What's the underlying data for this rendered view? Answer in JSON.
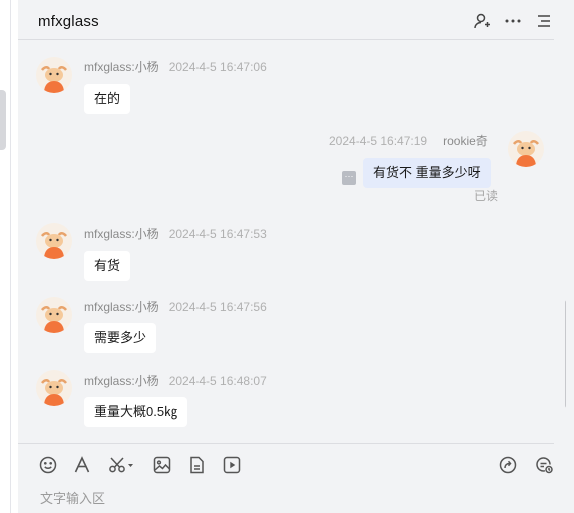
{
  "header": {
    "title": "mfxglass",
    "icons": [
      "add-user-icon",
      "more-icon",
      "list-icon"
    ]
  },
  "messages": [
    {
      "side": "left",
      "name": "mfxglass:小杨",
      "time": "2024-4-5 16:47:06",
      "text": "在的"
    },
    {
      "side": "right",
      "name": "rookie奇",
      "time": "2024-4-5 16:47:19",
      "text": "有货不  重量多少呀",
      "status": "已读"
    },
    {
      "side": "left",
      "name": "mfxglass:小杨",
      "time": "2024-4-5 16:47:53",
      "text": "有货"
    },
    {
      "side": "left",
      "name": "mfxglass:小杨",
      "time": "2024-4-5 16:47:56",
      "text": "需要多少"
    },
    {
      "side": "left",
      "name": "mfxglass:小杨",
      "time": "2024-4-5 16:48:07",
      "text": "重量大概0.5㎏"
    }
  ],
  "toolbar": {
    "icons": [
      "emoji-icon",
      "font-icon",
      "scissors-icon",
      "image-icon",
      "file-icon",
      "video-icon",
      "share-icon",
      "history-icon"
    ]
  },
  "input": {
    "placeholder": "文字输入区"
  },
  "colors": {
    "background": "#f2f3f5",
    "bubble_other": "#ffffff",
    "bubble_mine": "#e4ebfb",
    "avatar_orange": "#f2753b"
  }
}
